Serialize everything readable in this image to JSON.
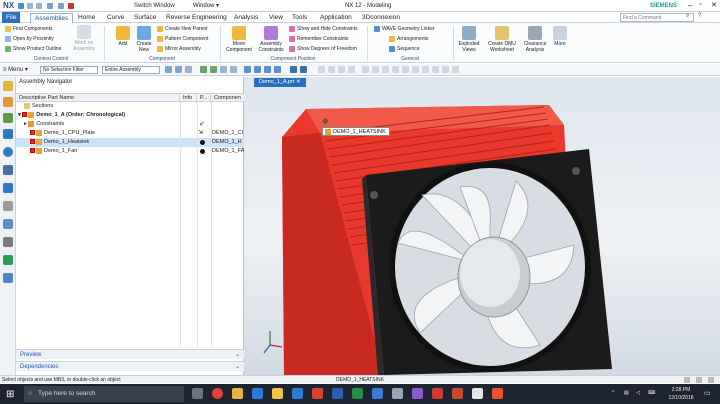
{
  "app": {
    "logo": "NX",
    "switch_window": "Switch Window",
    "window_menu": "Window",
    "title": "NX 12 - Modeling",
    "brand": "SIEMENS",
    "find_command_placeholder": "Find a Command"
  },
  "ribbon_tabs": [
    "File",
    "Assemblies",
    "Home",
    "Curve",
    "Surface",
    "Reverse Engineering",
    "Analysis",
    "View",
    "Tools",
    "Application",
    "3Dconnexion"
  ],
  "ribbon": {
    "context_control": {
      "items": [
        "Find Components",
        "Open by Proximity",
        "Show Product Outline"
      ],
      "work_on_assembly": "Work on Assembly",
      "label": "Context Control"
    },
    "component": {
      "add": "Add",
      "create_new": "Create New",
      "items": [
        "Create New Parent",
        "Pattern Component",
        "Mirror Assembly"
      ],
      "label": "Component"
    },
    "component_position": {
      "move": "Move Component",
      "constraints": "Assembly Constraints",
      "items": [
        "Show and Hide Constraints",
        "Remember Constraints",
        "Show Degrees of Freedom"
      ],
      "label": "Component Position"
    },
    "general": {
      "items": [
        "WAVE Geometry Linker",
        "Arrangements",
        "Sequence"
      ],
      "label": "General"
    },
    "right_buttons": [
      "Exploded Views",
      "Create DMU Worksheet",
      "Clearance Analysis",
      "More"
    ]
  },
  "toolbar": {
    "menu": "Menu",
    "filter": "No Selection Filter",
    "scope": "Entire Assembly"
  },
  "navigator": {
    "title": "Assembly Navigator",
    "columns": [
      "Descriptive Part Name",
      "Info",
      "P...",
      "Componen"
    ],
    "rows": [
      {
        "name": "Sections",
        "comp": ""
      },
      {
        "name": "Demo_1_A (Order: Chronological)",
        "comp": ""
      },
      {
        "name": "Constraints",
        "comp": ""
      },
      {
        "name": "Demo_1_CPU_Plate",
        "comp": "DEMO_1_CI"
      },
      {
        "name": "Demo_1_Heatsink",
        "comp": "DEMO_1_H"
      },
      {
        "name": "Demo_1_Fan",
        "comp": "DEMO_1_FA"
      }
    ],
    "preview": "Preview",
    "dependencies": "Dependencies"
  },
  "viewport": {
    "tab": "Demo_1_A.prt",
    "tooltip": "DEMO_1_HEATSINK"
  },
  "status": {
    "message": "Select objects and use MB3, or double-click an object",
    "selection": "DEMO_1_HEATSINK"
  },
  "taskbar": {
    "search_placeholder": "Type here to search",
    "time": "2:28 PM",
    "date": "12/10/2018"
  },
  "colors": {
    "accent": "#2a6fbf",
    "heatsink": "#e8392c",
    "fan": "#1b1b1b"
  }
}
